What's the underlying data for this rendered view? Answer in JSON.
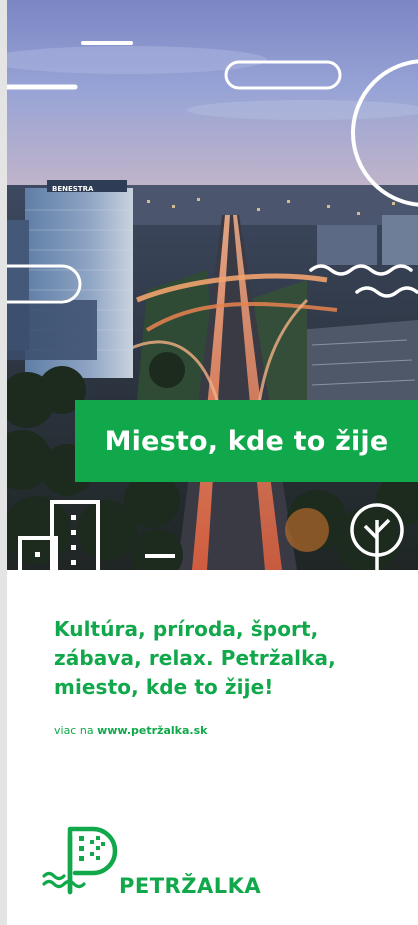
{
  "hero": {
    "headline": "Miesto, kde to žije",
    "building_sign": "BENESTRA"
  },
  "body": {
    "text": "Kultúra, príroda, šport, zábava, relax. Petržalka, miesto, kde to žije!",
    "more_prefix": "viac na",
    "more_link": "www.petržalka.sk"
  },
  "logo": {
    "name": "PETRŽALKA"
  },
  "colors": {
    "brand_green": "#10a84a",
    "white": "#ffffff"
  }
}
